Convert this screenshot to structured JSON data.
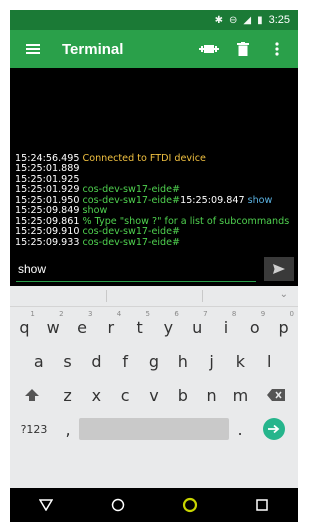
{
  "status_bar": {
    "time": "3:25",
    "icons": [
      "bluetooth-icon",
      "do-not-disturb-icon",
      "signal-icon",
      "battery-icon"
    ]
  },
  "app_bar": {
    "title": "Terminal",
    "actions": [
      "connect-plug-icon",
      "delete-icon",
      "overflow-menu-icon"
    ],
    "color": "#2aa04a"
  },
  "terminal": {
    "lines": [
      {
        "time": "15:24:56.495",
        "segments": [
          {
            "text": "Connected to FTDI device",
            "color": "yellow"
          }
        ]
      },
      {
        "time": "15:25:01.889",
        "segments": []
      },
      {
        "time": "15:25:01.925",
        "segments": []
      },
      {
        "time": "15:25:01.929",
        "segments": [
          {
            "text": "cos-dev-sw17-eide#",
            "color": "green"
          }
        ]
      },
      {
        "time": "15:25:01.950",
        "segments": [
          {
            "text": "cos-dev-sw17-eide#",
            "color": "green"
          },
          {
            "text": "15:25:09.847",
            "color": "white"
          },
          {
            "text": "show",
            "color": "blue"
          }
        ]
      },
      {
        "time": "15:25:09.849",
        "segments": [
          {
            "text": "show",
            "color": "green"
          }
        ]
      },
      {
        "time": "15:25:09.861",
        "segments": [
          {
            "text": "% Type \"show ?\" for a list of subcommands",
            "color": "green"
          }
        ]
      },
      {
        "time": "15:25:09.910",
        "segments": [
          {
            "text": "cos-dev-sw17-eide#",
            "color": "green"
          }
        ]
      },
      {
        "time": "15:25:09.933",
        "segments": [
          {
            "text": "cos-dev-sw17-eide#",
            "color": "green"
          }
        ]
      }
    ]
  },
  "input": {
    "value": "show",
    "send_icon": "send-icon"
  },
  "keyboard": {
    "row1": [
      {
        "key": "q",
        "sup": "1"
      },
      {
        "key": "w",
        "sup": "2"
      },
      {
        "key": "e",
        "sup": "3"
      },
      {
        "key": "r",
        "sup": "4"
      },
      {
        "key": "t",
        "sup": "5"
      },
      {
        "key": "y",
        "sup": "6"
      },
      {
        "key": "u",
        "sup": "7"
      },
      {
        "key": "i",
        "sup": "8"
      },
      {
        "key": "o",
        "sup": "9"
      },
      {
        "key": "p",
        "sup": "0"
      }
    ],
    "row2": [
      "a",
      "s",
      "d",
      "f",
      "g",
      "h",
      "j",
      "k",
      "l"
    ],
    "row3": [
      "z",
      "x",
      "c",
      "v",
      "b",
      "n",
      "m"
    ],
    "symbols_label": "?123",
    "comma": ",",
    "period": ".",
    "shift_icon": "shift-icon",
    "backspace_icon": "backspace-icon",
    "enter_icon": "enter-arrow-icon"
  },
  "nav_bar": {
    "buttons": [
      "back-icon",
      "home-icon",
      "recents-icon"
    ]
  }
}
